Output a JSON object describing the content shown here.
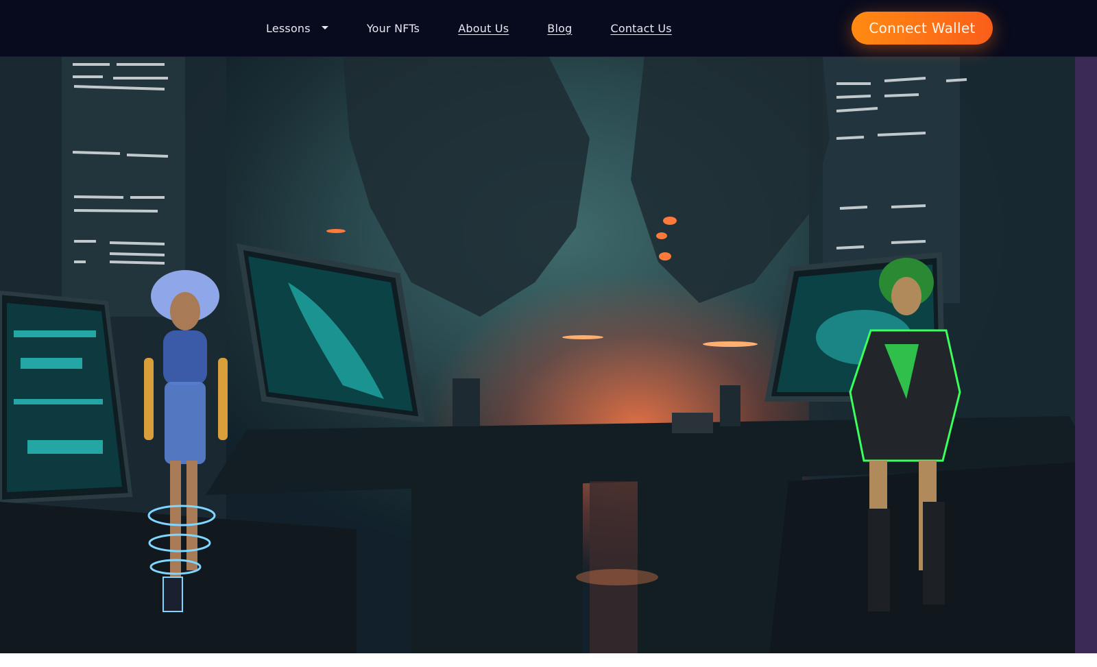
{
  "nav": {
    "items": [
      {
        "label": "Lessons",
        "dropdown": true
      },
      {
        "label": "Your NFTs"
      },
      {
        "label": "About Us"
      },
      {
        "label": "Blog"
      },
      {
        "label": "Contact Us"
      }
    ],
    "connect_label": "Connect Wallet"
  },
  "colors": {
    "nav_bg": "#080b1d",
    "accent_orange": "#ff8a12",
    "screen_cyan": "#2fd6d0",
    "char1_hologram": "#7fd6ff",
    "char2_glow": "#3bff5a"
  }
}
